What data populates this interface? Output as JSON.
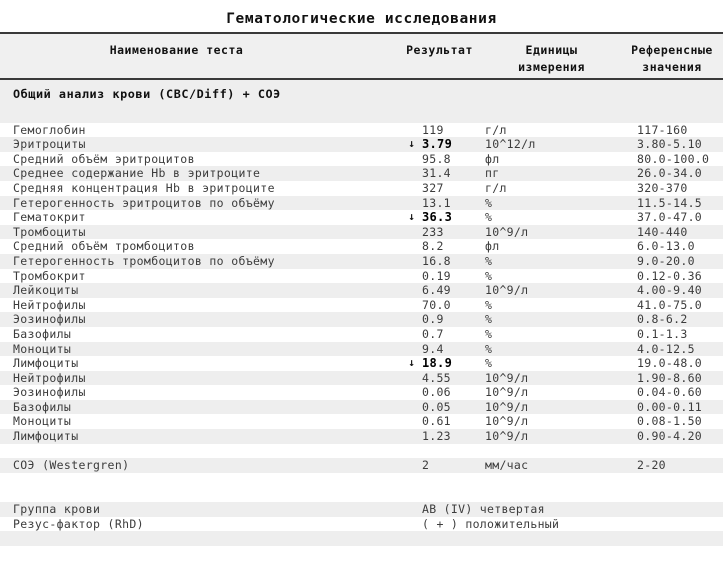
{
  "report": {
    "title": "Гематологические исследования",
    "columns": {
      "name": "Наименование теста",
      "result": "Результат",
      "units_line1": "Единицы",
      "units_line2": "измерения",
      "reference_line1": "Референсные",
      "reference_line2": "значения"
    },
    "sections": [
      {
        "title": "Общий анализ крови (CBC/Diff) + СОЭ",
        "rows": [
          {
            "name": "Гемоглобин",
            "flag": "",
            "result": "119",
            "units": "г/л",
            "reference": "117-160"
          },
          {
            "name": "Эритроциты",
            "flag": "↓",
            "result": "3.79",
            "units": "10^12/л",
            "reference": "3.80-5.10"
          },
          {
            "name": "Средний объём эритроцитов",
            "flag": "",
            "result": "95.8",
            "units": "фл",
            "reference": "80.0-100.0"
          },
          {
            "name": "Среднее содержание Hb в эритроците",
            "flag": "",
            "result": "31.4",
            "units": "пг",
            "reference": "26.0-34.0"
          },
          {
            "name": "Средняя концентрация Hb в эритроците",
            "flag": "",
            "result": "327",
            "units": "г/л",
            "reference": "320-370"
          },
          {
            "name": "Гетерогенность эритроцитов по объёму",
            "flag": "",
            "result": "13.1",
            "units": "%",
            "reference": "11.5-14.5"
          },
          {
            "name": "Гематокрит",
            "flag": "↓",
            "result": "36.3",
            "units": "%",
            "reference": "37.0-47.0"
          },
          {
            "name": "Тромбоциты",
            "flag": "",
            "result": "233",
            "units": "10^9/л",
            "reference": "140-440"
          },
          {
            "name": "Средний объём тромбоцитов",
            "flag": "",
            "result": "8.2",
            "units": "фл",
            "reference": "6.0-13.0"
          },
          {
            "name": "Гетерогенность тромбоцитов по объёму",
            "flag": "",
            "result": "16.8",
            "units": "%",
            "reference": "9.0-20.0"
          },
          {
            "name": "Тромбокрит",
            "flag": "",
            "result": "0.19",
            "units": "%",
            "reference": "0.12-0.36"
          },
          {
            "name": "Лейкоциты",
            "flag": "",
            "result": "6.49",
            "units": "10^9/л",
            "reference": "4.00-9.40"
          },
          {
            "name": "Нейтрофилы",
            "flag": "",
            "result": "70.0",
            "units": "%",
            "reference": "41.0-75.0"
          },
          {
            "name": "Эозинофилы",
            "flag": "",
            "result": "0.9",
            "units": "%",
            "reference": "0.8-6.2"
          },
          {
            "name": "Базофилы",
            "flag": "",
            "result": "0.7",
            "units": "%",
            "reference": "0.1-1.3"
          },
          {
            "name": "Моноциты",
            "flag": "",
            "result": "9.4",
            "units": "%",
            "reference": "4.0-12.5"
          },
          {
            "name": "Лимфоциты",
            "flag": "↓",
            "result": "18.9",
            "units": "%",
            "reference": "19.0-48.0"
          },
          {
            "name": "Нейтрофилы",
            "flag": "",
            "result": "4.55",
            "units": "10^9/л",
            "reference": "1.90-8.60"
          },
          {
            "name": "Эозинофилы",
            "flag": "",
            "result": "0.06",
            "units": "10^9/л",
            "reference": "0.04-0.60"
          },
          {
            "name": "Базофилы",
            "flag": "",
            "result": "0.05",
            "units": "10^9/л",
            "reference": "0.00-0.11"
          },
          {
            "name": "Моноциты",
            "flag": "",
            "result": "0.61",
            "units": "10^9/л",
            "reference": "0.08-1.50"
          },
          {
            "name": "Лимфоциты",
            "flag": "",
            "result": "1.23",
            "units": "10^9/л",
            "reference": "0.90-4.20"
          }
        ]
      }
    ],
    "esr": {
      "name": "СОЭ (Westergren)",
      "flag": "",
      "result": "2",
      "units": "мм/час",
      "reference": "2-20"
    },
    "blood_group": [
      {
        "name": "Группа крови",
        "result": "AB (IV) четвертая"
      },
      {
        "name": "Резус-фактор (RhD)",
        "result": "( + ) положительный"
      }
    ]
  },
  "colors": {
    "shade_row": "#eeeeee",
    "header_band": "#f0f0f0",
    "rule": "#3a3a3a",
    "text": "#3c3c3c",
    "flag_text": "#000000"
  }
}
